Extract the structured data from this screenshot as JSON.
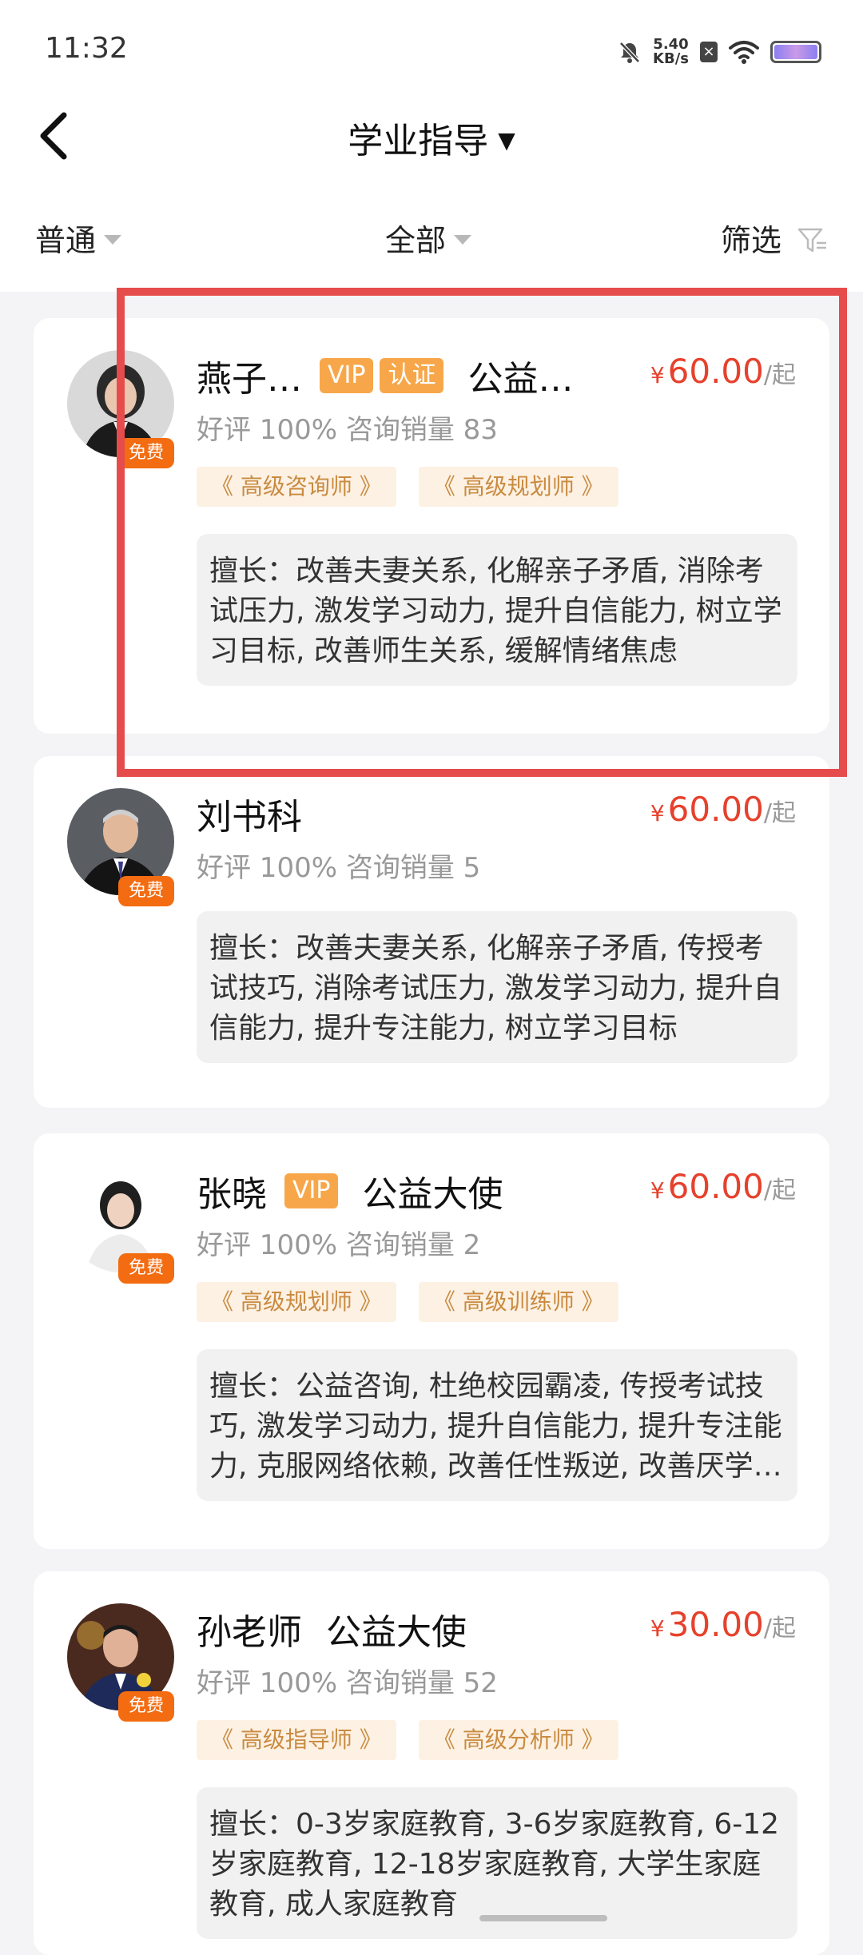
{
  "status": {
    "time": "11:32",
    "speed_value": "5.40",
    "speed_unit": "KB/s"
  },
  "nav": {
    "title": "学业指导"
  },
  "filters": {
    "sort": "普通",
    "category": "全部",
    "filter": "筛选"
  },
  "cards": [
    {
      "name": "燕子…",
      "badges": [
        "VIP",
        "认证"
      ],
      "extra": "公益…",
      "currency": "¥",
      "price": "60.00",
      "unit": "/起",
      "stats": "好评 100% 咨询销量 83",
      "tags": [
        "《 高级咨询师 》",
        "《 高级规划师 》"
      ],
      "free": "免费",
      "expertise": "擅长：改善夫妻关系, 化解亲子矛盾, 消除考试压力, 激发学习动力, 提升自信能力, 树立学习目标, 改善师生关系, 缓解情绪焦虑"
    },
    {
      "name": "刘书科",
      "currency": "¥",
      "price": "60.00",
      "unit": "/起",
      "stats": "好评 100% 咨询销量 5",
      "free": "免费",
      "expertise": "擅长：改善夫妻关系, 化解亲子矛盾, 传授考试技巧, 消除考试压力, 激发学习动力, 提升自信能力, 提升专注能力, 树立学习目标"
    },
    {
      "name": "张晓",
      "badges": [
        "VIP"
      ],
      "extra": "公益大使",
      "currency": "¥",
      "price": "60.00",
      "unit": "/起",
      "stats": "好评 100% 咨询销量 2",
      "tags": [
        "《 高级规划师 》",
        "《 高级训练师 》"
      ],
      "free": "免费",
      "expertise": "擅长：公益咨询, 杜绝校园霸凌, 传授考试技巧, 激发学习动力, 提升自信能力, 提升专注能力, 克服网络依赖, 改善任性叛逆, 改善厌学情绪"
    },
    {
      "name": "孙老师",
      "extra": "公益大使",
      "currency": "¥",
      "price": "30.00",
      "unit": "/起",
      "stats": "好评 100% 咨询销量 52",
      "tags": [
        "《 高级指导师 》",
        "《 高级分析师 》"
      ],
      "free": "免费",
      "expertise": "擅长：0-3岁家庭教育, 3-6岁家庭教育, 6-12岁家庭教育, 12-18岁家庭教育, 大学生家庭教育, 成人家庭教育"
    }
  ],
  "colors": {
    "price": "#e6412c",
    "badge": "#f7a74a",
    "free_tag": "#f36c12",
    "highlight": "#e74c4c"
  }
}
